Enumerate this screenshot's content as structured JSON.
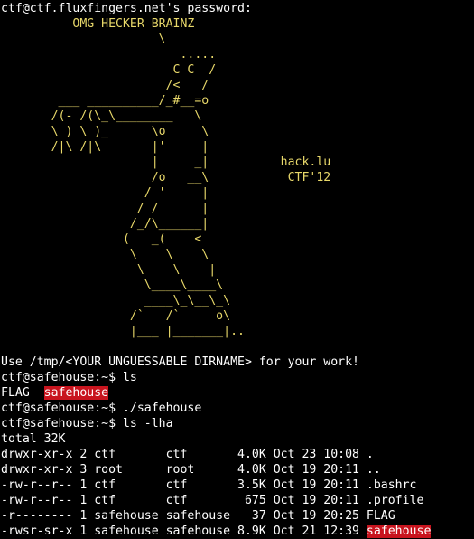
{
  "colors": {
    "background": "#000000",
    "text": "#ffffff",
    "banner": "#e8d86a",
    "highlight_bg": "#c8141e"
  },
  "lines": [
    "ctf@ctf.fluxfingers.net's password:",
    "          OMG HECKER BRAINZ",
    "                      \\",
    "                         .....",
    "                        C C  /",
    "                       /<   /",
    "        ___ __________/_#__=o",
    "       /(- /(\\_\\________   \\",
    "       \\ ) \\ )_      \\o     \\",
    "       /|\\ /|\\       |'     |",
    "                     |     _|          hack.lu",
    "                     /o   __\\           CTF'12",
    "                    / '     |",
    "                   / /      |",
    "                  /_/\\______|",
    "                 (   _(    <",
    "                  \\    \\    \\",
    "                   \\    \\    |",
    "                    \\____\\____\\",
    "                    ____\\_\\__\\_\\",
    "                  /`   /`     o\\",
    "                  |___ |_______|..",
    "",
    "Use /tmp/<YOUR UNGUESSABLE DIRNAME> for your work!",
    "ctf@safehouse:~$ ls",
    "FLAG  ",
    "ctf@safehouse:~$ ./safehouse",
    "ctf@safehouse:~$ ls -lha",
    "total 32K",
    "drwxr-xr-x 2 ctf       ctf       4.0K Oct 23 10:08 .",
    "drwxr-xr-x 3 root      root      4.0K Oct 19 20:11 ..",
    "-rw-r--r-- 1 ctf       ctf       3.5K Oct 19 20:11 .bashrc",
    "-rw-r--r-- 1 ctf       ctf        675 Oct 19 20:11 .profile",
    "-r-------- 1 safehouse safehouse   37 Oct 19 20:25 FLAG",
    "-rwsr-sr-x 1 safehouse safehouse 8.9K Oct 21 12:39 "
  ],
  "highlights": {
    "ls_safehouse": "safehouse",
    "lha_safehouse": "safehouse"
  }
}
